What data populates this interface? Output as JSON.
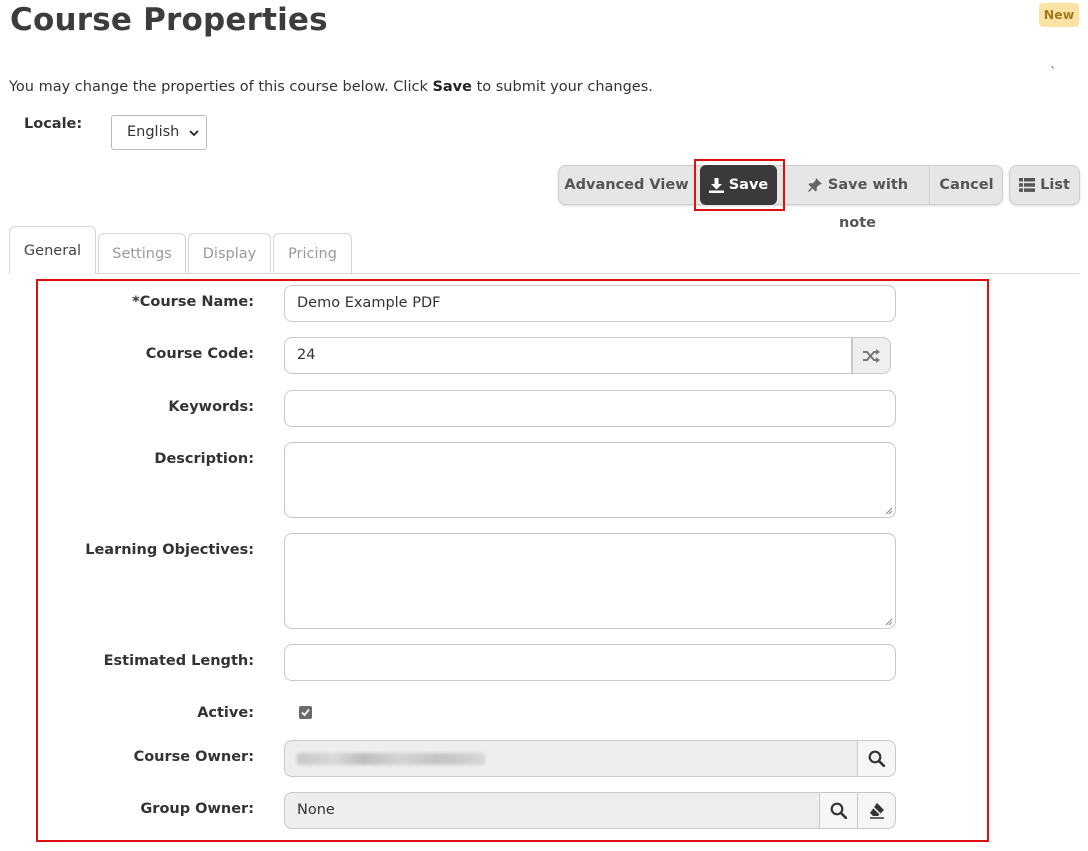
{
  "header": {
    "title": "Course Properties",
    "badge": "New",
    "tick": "`",
    "intro_before": "You may change the properties of this course below. Click ",
    "intro_bold": "Save",
    "intro_after": " to submit your changes."
  },
  "locale": {
    "label": "Locale:",
    "value": "English"
  },
  "toolbar": {
    "advanced_view": "Advanced View",
    "save": "Save",
    "save_with_note": "Save with note",
    "cancel": "Cancel",
    "list": "List"
  },
  "tabs": [
    {
      "label": "General",
      "active": true
    },
    {
      "label": "Settings",
      "active": false
    },
    {
      "label": "Display",
      "active": false
    },
    {
      "label": "Pricing",
      "active": false
    }
  ],
  "form": {
    "course_name": {
      "label": "*Course Name:",
      "value": "Demo Example PDF"
    },
    "course_code": {
      "label": "Course Code:",
      "value": "24"
    },
    "keywords": {
      "label": "Keywords:",
      "value": ""
    },
    "description": {
      "label": "Description:",
      "value": ""
    },
    "learning_objectives": {
      "label": "Learning Objectives:",
      "value": ""
    },
    "estimated_length": {
      "label": "Estimated Length:",
      "value": ""
    },
    "active": {
      "label": "Active:",
      "checked": true
    },
    "course_owner": {
      "label": "Course Owner:"
    },
    "group_owner": {
      "label": "Group Owner:",
      "value": "None"
    }
  },
  "colors": {
    "highlight": "#e01010",
    "save_button": "#3a3a3a",
    "badge_bg": "#fbe3a3"
  }
}
